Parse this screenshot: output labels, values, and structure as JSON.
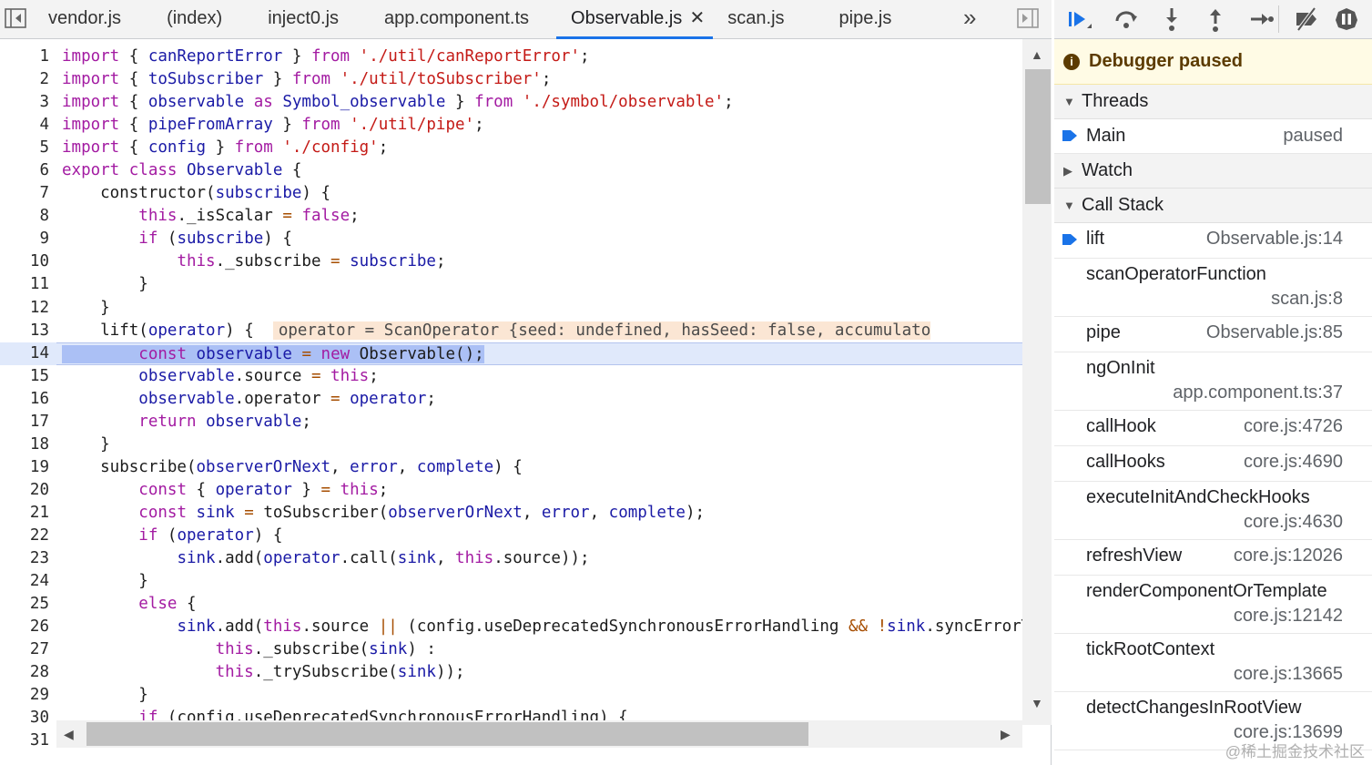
{
  "tabs": [
    "vendor.js",
    "(index)",
    "inject0.js",
    "app.component.ts",
    "Observable.js",
    "scan.js",
    "pipe.js"
  ],
  "active_tab": "Observable.js",
  "tab_close_glyph": "✕",
  "tab_overflow_glyph": "»",
  "line_numbers": [
    "1",
    "2",
    "3",
    "4",
    "5",
    "6",
    "7",
    "8",
    "9",
    "10",
    "11",
    "12",
    "13",
    "14",
    "15",
    "16",
    "17",
    "18",
    "19",
    "20",
    "21",
    "22",
    "23",
    "24",
    "25",
    "26",
    "27",
    "28",
    "29",
    "30",
    "31"
  ],
  "current_line": 14,
  "inline_value": "operator = ScanOperator {seed: undefined, hasSeed: false, accumulato",
  "debugger": {
    "banner": "Debugger paused",
    "banner_icon": "info-icon",
    "threads": {
      "label": "Threads",
      "items": [
        {
          "name": "Main",
          "status": "paused"
        }
      ]
    },
    "watch": {
      "label": "Watch"
    },
    "call_stack": {
      "label": "Call Stack",
      "frames": [
        {
          "fn": "lift",
          "loc": "Observable.js:14",
          "current": true
        },
        {
          "fn": "scanOperatorFunction",
          "loc": "scan.js:8"
        },
        {
          "fn": "pipe",
          "loc": "Observable.js:85"
        },
        {
          "fn": "ngOnInit",
          "loc": "app.component.ts:37"
        },
        {
          "fn": "callHook",
          "loc": "core.js:4726"
        },
        {
          "fn": "callHooks",
          "loc": "core.js:4690"
        },
        {
          "fn": "executeInitAndCheckHooks",
          "loc": "core.js:4630"
        },
        {
          "fn": "refreshView",
          "loc": "core.js:12026"
        },
        {
          "fn": "renderComponentOrTemplate",
          "loc": "core.js:12142"
        },
        {
          "fn": "tickRootContext",
          "loc": "core.js:13665"
        },
        {
          "fn": "detectChangesInRootView",
          "loc": "core.js:13699"
        }
      ]
    }
  },
  "watermark": "@稀土掘金技术社区"
}
